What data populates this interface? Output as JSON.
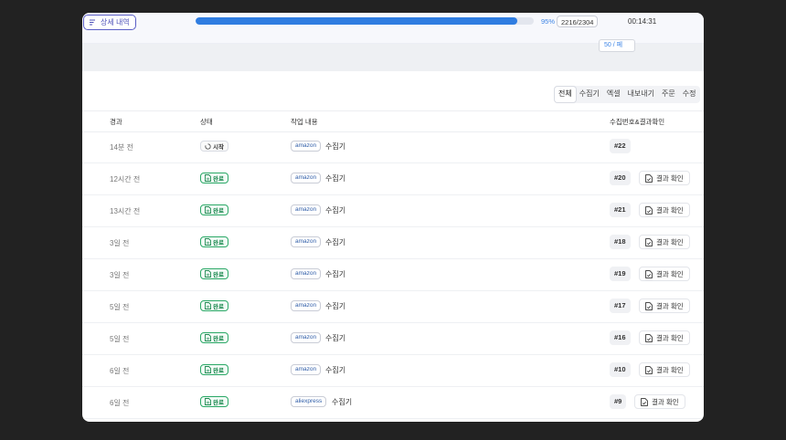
{
  "header": {
    "detail_label": "상세 내역",
    "progress_fraction": 0.95,
    "progress_pct": "95%",
    "progress_count": "2216/2304",
    "timer": "00:14:31",
    "page_size": "50 / 페"
  },
  "filters": [
    "전체",
    "수집기",
    "엑셀",
    "내보내기",
    "주문",
    "수정"
  ],
  "columns": {
    "time": "경과",
    "status": "상태",
    "task": "작업 내용",
    "result": "수집번호&결과확인"
  },
  "rows": [
    {
      "time": "14분 전",
      "status": "시작",
      "site": "amazon",
      "task": "수집기",
      "num": "#22",
      "result": ""
    },
    {
      "time": "12시간 전",
      "status": "완료",
      "site": "amazon",
      "task": "수집기",
      "num": "#20",
      "result": "결과 확인"
    },
    {
      "time": "13시간 전",
      "status": "완료",
      "site": "amazon",
      "task": "수집기",
      "num": "#21",
      "result": "결과 확인"
    },
    {
      "time": "3일 전",
      "status": "완료",
      "site": "amazon",
      "task": "수집기",
      "num": "#18",
      "result": "결과 확인"
    },
    {
      "time": "3일 전",
      "status": "완료",
      "site": "amazon",
      "task": "수집기",
      "num": "#19",
      "result": "결과 확인"
    },
    {
      "time": "5일 전",
      "status": "완료",
      "site": "amazon",
      "task": "수집기",
      "num": "#17",
      "result": "결과 확인"
    },
    {
      "time": "5일 전",
      "status": "완료",
      "site": "amazon",
      "task": "수집기",
      "num": "#16",
      "result": "결과 확인"
    },
    {
      "time": "6일 전",
      "status": "완료",
      "site": "amazon",
      "task": "수집기",
      "num": "#10",
      "result": "결과 확인"
    },
    {
      "time": "6일 전",
      "status": "완료",
      "site": "aliexpress",
      "task": "수집기",
      "num": "#9",
      "result": "결과 확인"
    }
  ]
}
